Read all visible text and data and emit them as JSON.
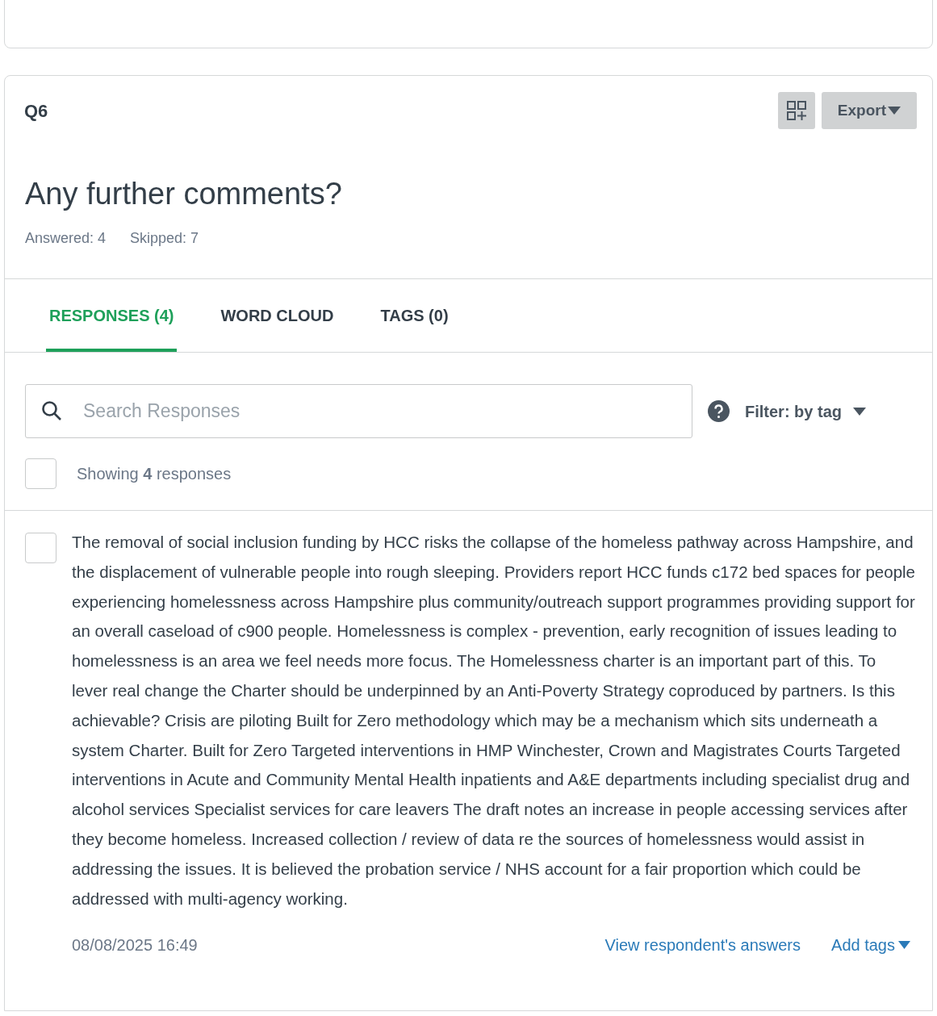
{
  "question": {
    "number": "Q6",
    "title": "Any further comments?",
    "answered": "Answered: 4",
    "skipped": "Skipped: 7"
  },
  "toolbar": {
    "export": "Export"
  },
  "tabs": [
    {
      "label": "RESPONSES (4)",
      "selected": true
    },
    {
      "label": "WORD CLOUD",
      "selected": false
    },
    {
      "label": "TAGS (0)",
      "selected": false
    }
  ],
  "search": {
    "placeholder": "Search Responses"
  },
  "filter": {
    "label": "Filter: by tag"
  },
  "select_all": {
    "checked": false,
    "summary": "Showing **4** responses"
  },
  "responses": [
    {
      "checked": false,
      "text": "The removal of social inclusion funding by HCC risks the collapse of the homeless pathway across Hampshire, and the displacement of vulnerable people into rough sleeping. Providers report HCC funds c172 bed spaces for people experiencing homelessness across Hampshire plus community/outreach support programmes providing support for an overall caseload of c900 people. Homelessness is complex - prevention, early recognition of issues leading to homelessness is an area we feel needs more focus. The Homelessness charter is an important part of this. To lever real change the Charter should be underpinned by an Anti-Poverty Strategy coproduced by partners. Is this achievable? Crisis are piloting Built for Zero methodology which may be a mechanism which sits underneath a system Charter. Built for Zero Targeted interventions in HMP Winchester, Crown and Magistrates Courts Targeted interventions in Acute and Community Mental Health inpatients and A&E departments including specialist drug and alcohol services Specialist services for care leavers The draft notes an increase in people accessing services after they become homeless. Increased collection / review of data re the sources of homelessness would assist in addressing the issues. It is believed the probation service / NHS account for a fair proportion which could be addressed with multi-agency working.",
      "date": "08/08/2025 16:49",
      "view_link": "View respondent's answers",
      "tags_link": "Add tags"
    }
  ]
}
